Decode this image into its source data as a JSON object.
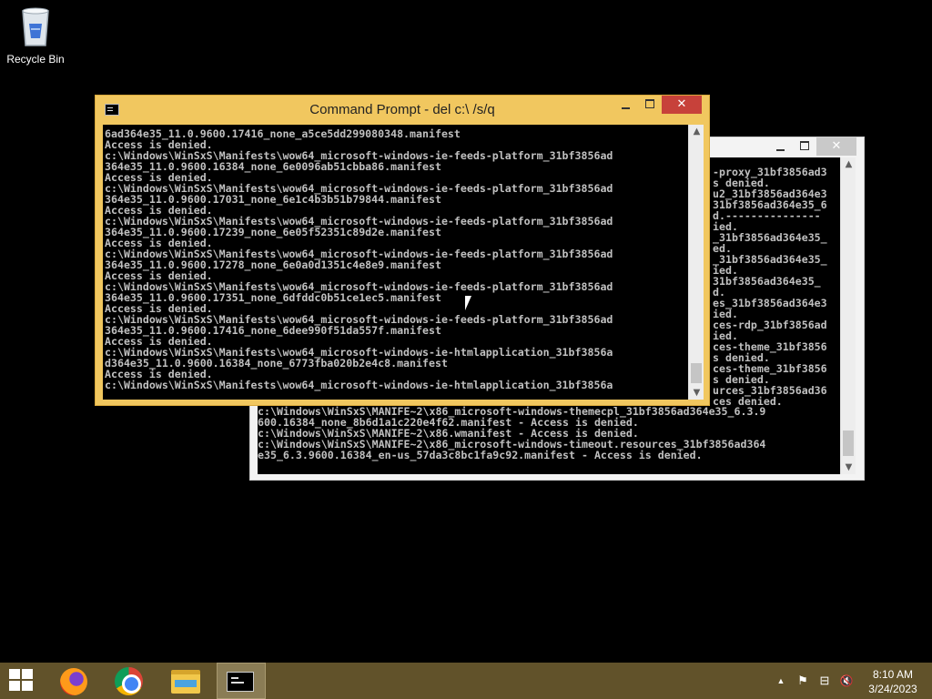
{
  "desktop": {
    "icons": [
      {
        "label": "Recycle Bin",
        "icon": "recycle-bin-icon"
      }
    ]
  },
  "back_window": {
    "controls": {
      "minimize": "minimize",
      "maximize": "maximize",
      "close": "✕"
    },
    "right_lines": [
      "-proxy_31bf3856ad3",
      "s denied.",
      "u2_31bf3856ad364e3",
      "31bf3856ad364e35_6",
      "d.---------------",
      "ied.",
      "_31bf3856ad364e35_",
      "ed.",
      "_31bf3856ad364e35_",
      "ied.",
      "31bf3856ad364e35_",
      "d.",
      "es_31bf3856ad364e3",
      "ied.",
      "ces-rdp_31bf3856ad",
      "ied.",
      "ces-theme_31bf3856",
      "s denied.",
      "ces-theme_31bf3856",
      "s denied.",
      "urces_31bf3856ad36",
      "ces denied."
    ],
    "bottom_lines": [
      "c:\\Windows\\WinSxS\\MANIFE~2\\x86_microsoft-windows-themecpl_31bf3856ad364e35_6.3.9",
      "600.16384_none_8b6d1a1c220e4f62.manifest - Access is denied.",
      "c:\\Windows\\WinSxS\\MANIFE~2\\x86.wmanifest - Access is denied.",
      "c:\\Windows\\WinSxS\\MANIFE~2\\x86_microsoft-windows-timeout.resources_31bf3856ad364",
      "e35_6.3.9600.16384_en-us_57da3c8bc1fa9c92.manifest - Access is denied."
    ]
  },
  "front_window": {
    "title": "Command Prompt - del  c:\\ /s/q",
    "controls": {
      "minimize": "minimize",
      "maximize": "maximize",
      "close": "✕"
    },
    "lines": [
      "6ad364e35_11.0.9600.17416_none_a5ce5dd299080348.manifest",
      "Access is denied.",
      "c:\\Windows\\WinSxS\\Manifests\\wow64_microsoft-windows-ie-feeds-platform_31bf3856ad",
      "364e35_11.0.9600.16384_none_6e0096ab51cbba86.manifest",
      "Access is denied.",
      "c:\\Windows\\WinSxS\\Manifests\\wow64_microsoft-windows-ie-feeds-platform_31bf3856ad",
      "364e35_11.0.9600.17031_none_6e1c4b3b51b79844.manifest",
      "Access is denied.",
      "c:\\Windows\\WinSxS\\Manifests\\wow64_microsoft-windows-ie-feeds-platform_31bf3856ad",
      "364e35_11.0.9600.17239_none_6e05f52351c89d2e.manifest",
      "Access is denied.",
      "c:\\Windows\\WinSxS\\Manifests\\wow64_microsoft-windows-ie-feeds-platform_31bf3856ad",
      "364e35_11.0.9600.17278_none_6e0a0d1351c4e8e9.manifest",
      "Access is denied.",
      "c:\\Windows\\WinSxS\\Manifests\\wow64_microsoft-windows-ie-feeds-platform_31bf3856ad",
      "364e35_11.0.9600.17351_none_6dfddc0b51ce1ec5.manifest",
      "Access is denied.",
      "c:\\Windows\\WinSxS\\Manifests\\wow64_microsoft-windows-ie-feeds-platform_31bf3856ad",
      "364e35_11.0.9600.17416_none_6dee990f51da557f.manifest",
      "Access is denied.",
      "c:\\Windows\\WinSxS\\Manifests\\wow64_microsoft-windows-ie-htmlapplication_31bf3856a",
      "d364e35_11.0.9600.16384_none_6773fba020b2e4c8.manifest",
      "Access is denied.",
      "c:\\Windows\\WinSxS\\Manifests\\wow64_microsoft-windows-ie-htmlapplication_31bf3856a"
    ]
  },
  "taskbar": {
    "buttons": [
      {
        "name": "start",
        "icon": "windows-logo-icon"
      },
      {
        "name": "firefox",
        "icon": "firefox-icon"
      },
      {
        "name": "chrome",
        "icon": "chrome-icon"
      },
      {
        "name": "file-explorer",
        "icon": "folder-icon"
      },
      {
        "name": "command-prompt",
        "icon": "cmd-icon",
        "active": true
      }
    ],
    "tray": {
      "chevron": "▲",
      "flag": "⚑",
      "network": "⊟",
      "volume": "🔇",
      "time": "8:10 AM",
      "date": "3/24/2023"
    }
  }
}
